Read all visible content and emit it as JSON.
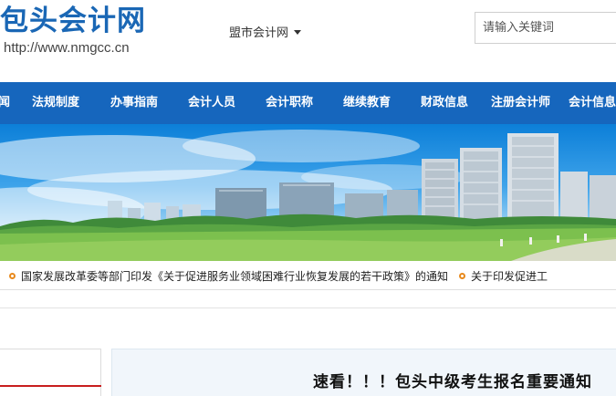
{
  "header": {
    "logo_title": "包头会计网",
    "logo_url": "http://www.nmgcc.cn",
    "city_selector": "盟市会计网",
    "search_placeholder": "请输入关键词"
  },
  "nav": {
    "items": [
      "闻",
      "法规制度",
      "办事指南",
      "会计人员",
      "会计职称",
      "继续教育",
      "财政信息",
      "注册会计师",
      "会计信息"
    ]
  },
  "ticker": {
    "items": [
      "国家发展改革委等部门印发《关于促进服务业领域困难行业恢复发展的若干政策》的通知",
      "关于印发促进工"
    ]
  },
  "main": {
    "headline": "速看！！！包头中级考生报名重要通知"
  },
  "colors": {
    "brand_blue": "#1666bd",
    "logo_blue": "#1a67b5",
    "bullet_orange": "#e8891c",
    "accent_red": "#c81e1e"
  }
}
